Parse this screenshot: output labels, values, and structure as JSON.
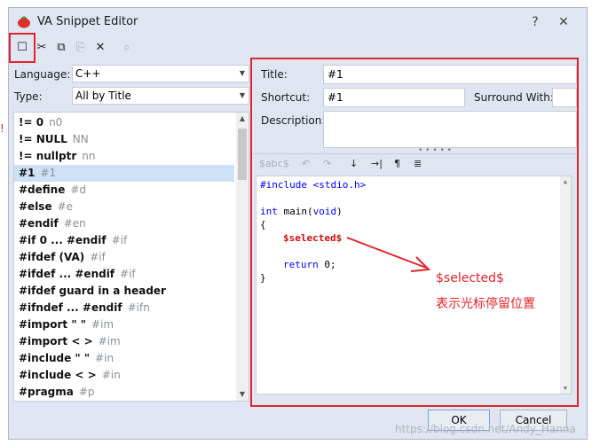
{
  "window": {
    "title": "VA Snippet Editor",
    "help": "?",
    "close": "✕"
  },
  "toolbar": {
    "new": "☐",
    "cut": "✂",
    "copy": "⧉",
    "paste": "⎘",
    "delete": "✕",
    "find": "⌕"
  },
  "left": {
    "language_label": "Language:",
    "language_value": "C++",
    "type_label": "Type:",
    "type_value": "All by Title",
    "items": [
      {
        "title": "!= 0",
        "shortcut": "n0"
      },
      {
        "title": "!= NULL",
        "shortcut": "NN"
      },
      {
        "title": "!= nullptr",
        "shortcut": "nn"
      },
      {
        "title": "#1",
        "shortcut": "#1",
        "selected": true
      },
      {
        "title": "#define",
        "shortcut": "#d"
      },
      {
        "title": "#else",
        "shortcut": "#e"
      },
      {
        "title": "#endif",
        "shortcut": "#en"
      },
      {
        "title": "#if 0 ... #endif",
        "shortcut": "#if"
      },
      {
        "title": "#ifdef (VA)",
        "shortcut": "#if"
      },
      {
        "title": "#ifdef ... #endif",
        "shortcut": "#if"
      },
      {
        "title": "#ifdef guard in a header",
        "shortcut": ""
      },
      {
        "title": "#ifndef ... #endif",
        "shortcut": "#ifn"
      },
      {
        "title": "#import \" \"",
        "shortcut": "#im"
      },
      {
        "title": "#import < >",
        "shortcut": "#im"
      },
      {
        "title": "#include \" \"",
        "shortcut": "#in"
      },
      {
        "title": "#include < >",
        "shortcut": "#in"
      },
      {
        "title": "#pragma",
        "shortcut": "#p"
      }
    ]
  },
  "right": {
    "title_label": "Title:",
    "title_value": "#1",
    "shortcut_label": "Shortcut:",
    "shortcut_value": "#1",
    "surround_label": "Surround With:",
    "description_label": "Description:",
    "editor_toolbar": {
      "abc": "$abc$",
      "undo": "↶",
      "redo": "↷",
      "sort": "↓",
      "indent": "→|",
      "pilcrow": "¶",
      "wrap": "≣"
    },
    "code": {
      "l1": "#include <stdio.h>",
      "l3_kw": "int",
      "l3_rest": " main(",
      "l3_kw2": "void",
      "l3_end": ")",
      "l4": "{",
      "l5": "$selected$",
      "l7_kw": "return",
      "l7_rest": " 0;",
      "l8": "}"
    }
  },
  "annotation": {
    "line1": "$selected$",
    "line2": "表示光标停留位置"
  },
  "buttons": {
    "ok": "OK",
    "cancel": "Cancel"
  },
  "watermark": "https://blog.csdn.net/Andy_Hanna",
  "colors": {
    "highlight": "#e0242a",
    "selection": "#cfe1f7",
    "keyword": "#0000ff"
  }
}
